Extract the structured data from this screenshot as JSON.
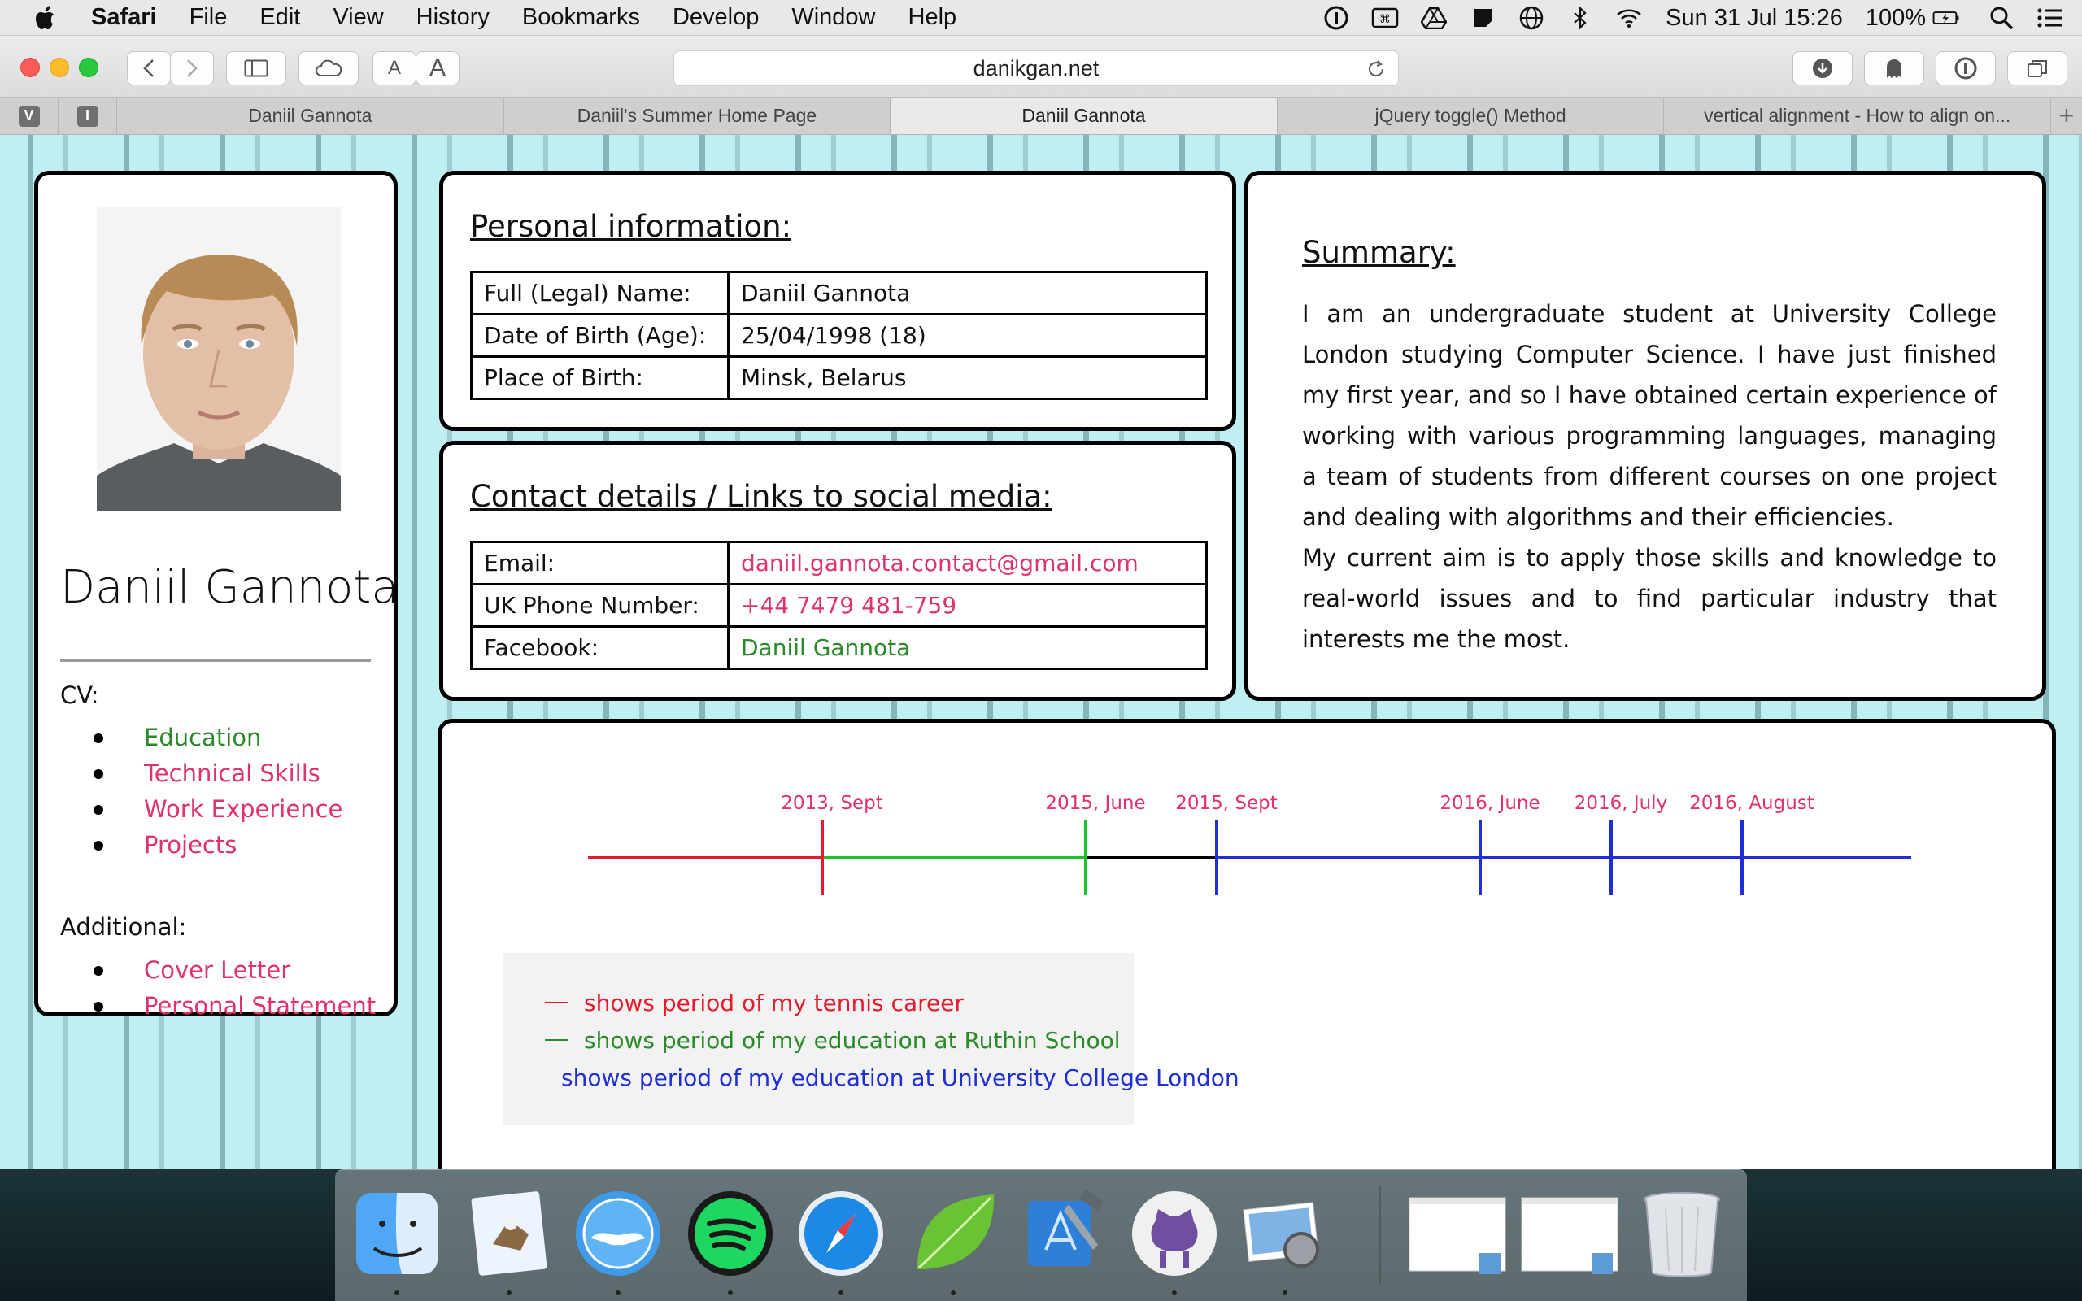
{
  "menubar": {
    "app_name": "Safari",
    "items": [
      "File",
      "Edit",
      "View",
      "History",
      "Bookmarks",
      "Develop",
      "Window",
      "Help"
    ],
    "clock": "Sun 31 Jul  15:26",
    "battery": "100%"
  },
  "browser": {
    "url": "danikgan.net",
    "font_small": "A",
    "font_large": "A",
    "pinned_tabs": [
      "V",
      "I"
    ],
    "tabs": [
      {
        "title": "Daniil Gannota",
        "active": false
      },
      {
        "title": "Daniil's Summer Home Page",
        "active": false
      },
      {
        "title": "Daniil Gannota",
        "active": true
      },
      {
        "title": "jQuery toggle() Method",
        "active": false
      },
      {
        "title": "vertical alignment - How to align on...",
        "active": false
      }
    ],
    "new_tab": "+"
  },
  "profile": {
    "name": "Daniil Gannota",
    "cv_heading": "CV:",
    "cv_links": [
      {
        "label": "Education",
        "color": "#2a8a2a"
      },
      {
        "label": "Technical Skills",
        "color": "#e0336a"
      },
      {
        "label": "Work Experience",
        "color": "#e0336a"
      },
      {
        "label": "Projects",
        "color": "#e0336a"
      }
    ],
    "additional_heading": "Additional:",
    "additional_links": [
      {
        "label": "Cover Letter",
        "color": "#e0336a"
      },
      {
        "label": "Personal Statement",
        "color": "#e0336a"
      }
    ]
  },
  "personal": {
    "title": "Personal information:",
    "rows": [
      {
        "key": "Full (Legal) Name:",
        "value": "Daniil Gannota"
      },
      {
        "key": "Date of Birth (Age):",
        "value": "25/04/1998 (18)"
      },
      {
        "key": "Place of Birth:",
        "value": "Minsk, Belarus"
      }
    ]
  },
  "contact": {
    "title": "Contact details / Links to social media:",
    "rows": [
      {
        "key": "Email:",
        "value": "daniil.gannota.contact@gmail.com"
      },
      {
        "key": "UK Phone Number:",
        "value": "+44 7479 481-759"
      },
      {
        "key": "Facebook:",
        "value": "Daniil Gannota"
      }
    ]
  },
  "summary": {
    "title": "Summary:",
    "paragraphs": [
      "I am an undergraduate student at University College London studying Computer Science. I have just finished my first year, and so I have obtained certain experience of working with various programming languages, managing a team of students from different courses on one project and dealing with algorithms and their efficiencies.",
      "My current aim is to apply those skills and knowledge to real-world issues and to find particular industry that interests me the most."
    ]
  },
  "timeline": {
    "label_color": "#e0336a",
    "marks": [
      "2013, Sept",
      "2015, June",
      "2015, Sept",
      "2016, June",
      "2016, July",
      "2016, August"
    ],
    "segments": [
      {
        "from": "start",
        "to": "2013, Sept",
        "color": "#e8192c"
      },
      {
        "from": "2013, Sept",
        "to": "2015, June",
        "color": "#22c02a"
      },
      {
        "from": "2015, June",
        "to": "2015, Sept",
        "color": "#000000"
      },
      {
        "from": "2015, Sept",
        "to": "end",
        "color": "#1f2fd6"
      }
    ],
    "tick_colors": [
      "#e8192c",
      "#22c02a",
      "#1f2fd6",
      "#1f2fd6",
      "#1f2fd6",
      "#1f2fd6"
    ],
    "legend": [
      {
        "text": "shows period of my tennis career",
        "color": "#e8192c"
      },
      {
        "text": "shows period of my education at Ruthin School",
        "color": "#2a8a2a"
      },
      {
        "text": "shows period of my education at University College London",
        "color": "#1f2fd6"
      }
    ]
  },
  "dock": {
    "apps": [
      "finder",
      "mail",
      "tweetbot",
      "spotify",
      "safari",
      "coda",
      "xcode",
      "github-desktop",
      "preview"
    ],
    "running": [
      "finder",
      "mail",
      "tweetbot",
      "spotify",
      "safari",
      "coda",
      "github-desktop",
      "preview"
    ],
    "extras": [
      "minimized-window",
      "minimized-window",
      "trash"
    ]
  }
}
